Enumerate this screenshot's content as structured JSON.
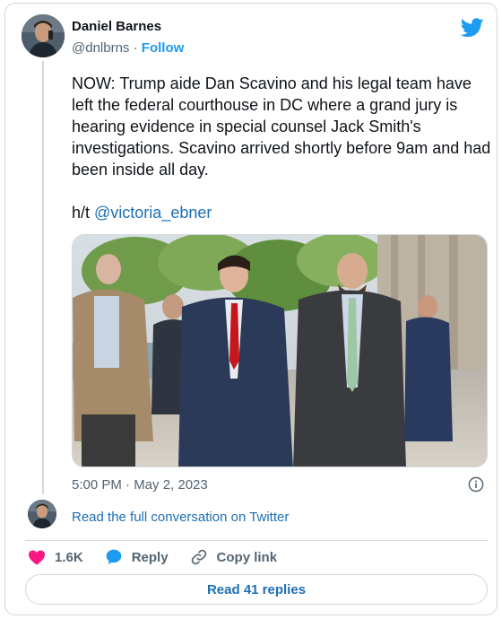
{
  "author": {
    "name": "Daniel Barnes",
    "handle": "@dnlbrns",
    "separator": "·",
    "follow_label": "Follow"
  },
  "tweet": {
    "paragraph1": "NOW: Trump aide Dan Scavino and his legal team have left the federal courthouse in DC where a grand jury is hearing evidence in special counsel Jack Smith's investigations. Scavino arrived shortly before 9am and had been inside all day.",
    "ht_prefix": "h/t ",
    "mention": "@victoria_ebner",
    "timestamp": "5:00 PM · May 2, 2023"
  },
  "conversation_link": "Read the full conversation on Twitter",
  "actions": {
    "likes": "1.6K",
    "reply_label": "Reply",
    "copy_label": "Copy link"
  },
  "read_replies_label": "Read 41 replies",
  "colors": {
    "accent": "#1d9bf0",
    "link": "#1d6fb4",
    "like": "#f91880",
    "text": "#0f1419",
    "muted": "#536471",
    "border": "#cfd9de"
  },
  "icons": {
    "brand": "twitter-bird-icon",
    "info": "info-icon",
    "like": "heart-icon",
    "reply": "speech-bubble-icon",
    "copy": "link-icon"
  }
}
